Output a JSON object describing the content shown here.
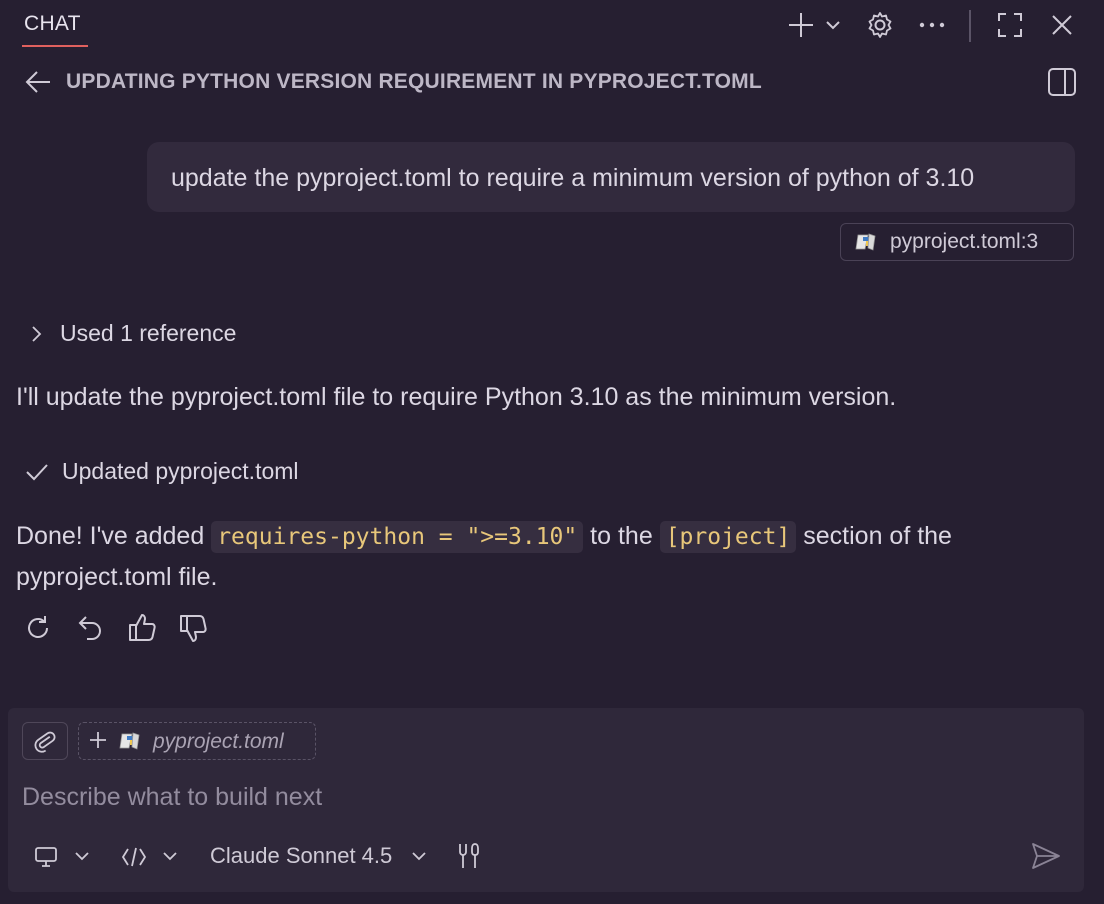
{
  "header": {
    "tab_label": "CHAT",
    "accent_color": "#e0605e",
    "icons": [
      "plus-icon",
      "chevron-down-icon",
      "gear-icon",
      "ellipsis-icon",
      "maximize-icon",
      "close-icon"
    ]
  },
  "conversation": {
    "title": "UPDATING PYTHON VERSION REQUIREMENT IN PYPROJECT.TOML",
    "user_message": "update the pyproject.toml to require a minimum version of python of 3.10",
    "user_reference": "pyproject.toml:3",
    "used_references_label": "Used 1 reference",
    "assistant_intro": "I'll update the pyproject.toml file to require Python 3.10 as the minimum version.",
    "edit_status": "Updated pyproject.toml",
    "summary": {
      "part1": "Done! I've added ",
      "code1": "requires-python = \">=3.10\"",
      "part2": " to the ",
      "code2": "[project]",
      "part3": " section of the pyproject.toml file."
    },
    "actions": [
      "retry-icon",
      "undo-icon",
      "thumbs-up-icon",
      "thumbs-down-icon"
    ]
  },
  "input": {
    "context_file": "pyproject.toml",
    "placeholder": "Describe what to build next",
    "model": "Claude Sonnet 4.5"
  }
}
